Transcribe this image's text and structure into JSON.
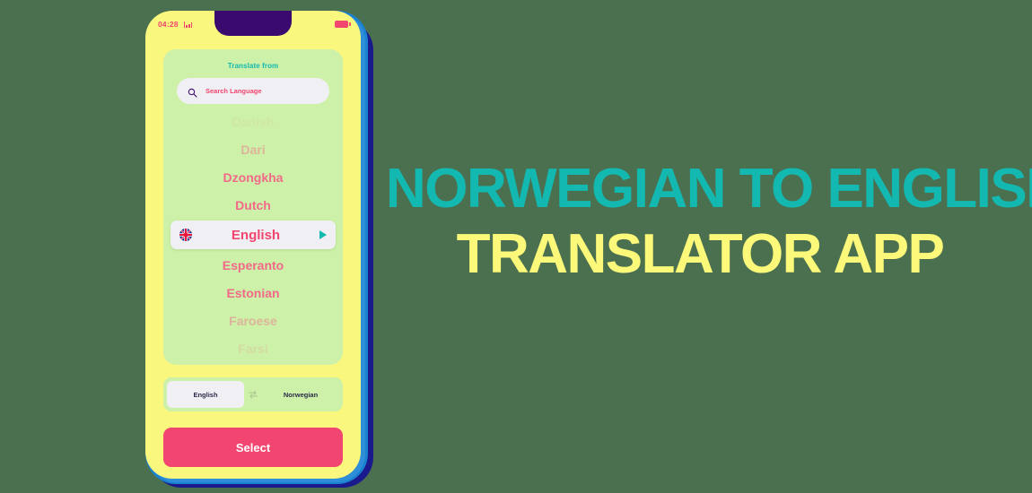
{
  "background_color": "#4a7050",
  "headline": {
    "line1": "NORWEGIAN TO ENGLISH",
    "line2": "TRANSLATOR APP",
    "line1_color": "#13b9b0",
    "line2_color": "#fbf87a"
  },
  "phone": {
    "frame_color": "#1b82d0",
    "body_color": "#faf77f",
    "notch_color": "#3a0a6e",
    "status_bar": {
      "time": "04:28",
      "signal_icon": "signal-bars-icon",
      "battery_icon": "battery-icon",
      "accent_color": "#f2456f"
    },
    "card": {
      "title": "Translate from",
      "title_color": "#13b9b0",
      "background": "#cdf1a8",
      "search": {
        "icon": "search-icon",
        "placeholder": "Search Language",
        "value": ""
      },
      "languages": [
        {
          "label": "Danish",
          "state": "faded-out"
        },
        {
          "label": "Dari",
          "state": "faded"
        },
        {
          "label": "Dzongkha",
          "state": "normal"
        },
        {
          "label": "Dutch",
          "state": "normal"
        },
        {
          "label": "English",
          "state": "selected",
          "flag": "uk-flag-icon",
          "play": "play-arrow-icon"
        },
        {
          "label": "Esperanto",
          "state": "normal"
        },
        {
          "label": "Estonian",
          "state": "normal"
        },
        {
          "label": "Faroese",
          "state": "faded"
        },
        {
          "label": "Farsi",
          "state": "faded-out"
        }
      ]
    },
    "swap_bar": {
      "source": "English",
      "swap_icon": "swap-arrows-icon",
      "target": "Norwegian"
    },
    "select_button": {
      "label": "Select",
      "color": "#f2456f"
    }
  }
}
